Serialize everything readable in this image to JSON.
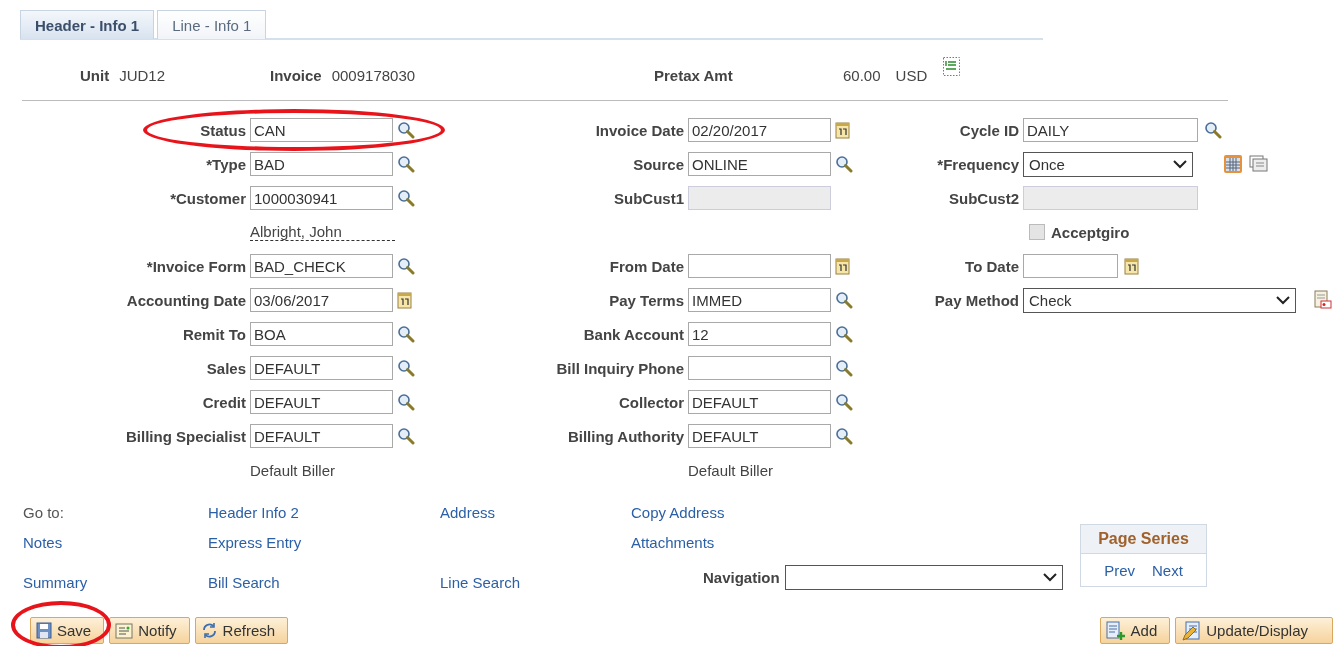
{
  "tabs": [
    {
      "label": "Header - Info 1",
      "selected": true
    },
    {
      "label": "Line - Info 1",
      "selected": false
    }
  ],
  "summary": [
    {
      "label": "Unit",
      "value": "JUD12"
    },
    {
      "label": "Invoice",
      "value": "0009178030"
    },
    {
      "label": "Pretax Amt",
      "value": "60.00",
      "currency": "USD"
    }
  ],
  "rows": [
    {
      "left": {
        "kind": "lookup",
        "label": "Status",
        "value": "CAN",
        "disabled": false,
        "circled": true
      },
      "middle": {
        "kind": "date",
        "label": "Invoice Date",
        "value": "02/20/2017",
        "disabled": false
      },
      "right": {
        "kind": "lookup",
        "label": "Cycle ID",
        "value": "DAILY",
        "disabled": false
      }
    },
    {
      "left": {
        "kind": "lookup",
        "label": "*Type",
        "value": "BAD",
        "disabled": false
      },
      "middle": {
        "kind": "lookup",
        "label": "Source",
        "value": "ONLINE",
        "disabled": false
      },
      "right": {
        "kind": "select",
        "label": "*Frequency",
        "value": "Once",
        "disabled": false
      }
    },
    {
      "left": {
        "kind": "lookup",
        "label": "*Customer",
        "value": "1000030941",
        "disabled": false
      },
      "middle": {
        "kind": "plain",
        "label": "SubCust1",
        "disabled": true
      },
      "right": {
        "kind": "plain",
        "label": "SubCust2",
        "disabled": true
      }
    },
    {
      "left": {
        "kind": "link",
        "value": "Albright, John"
      },
      "right": {
        "kind": "checkbox",
        "label": "Acceptgiro",
        "checked": false,
        "disabled": true
      }
    },
    {
      "left": {
        "kind": "lookup",
        "label": "*Invoice Form",
        "value": "BAD_CHECK",
        "disabled": false
      },
      "middle": {
        "kind": "date",
        "label": "From Date",
        "disabled": false
      },
      "right": {
        "kind": "date",
        "label": "To Date",
        "disabled": false
      }
    },
    {
      "left": {
        "kind": "date",
        "label": "Accounting Date",
        "value": "03/06/2017",
        "disabled": false
      },
      "middle": {
        "kind": "lookup",
        "label": "Pay Terms",
        "value": "IMMED",
        "disabled": false
      },
      "right": {
        "kind": "select",
        "label": "Pay Method",
        "value": "Check",
        "disabled": false
      }
    },
    {
      "left": {
        "kind": "lookup",
        "label": "Remit To",
        "value": "BOA",
        "disabled": false
      },
      "middle": {
        "kind": "lookup",
        "label": "Bank Account",
        "value": "12",
        "disabled": false
      }
    },
    {
      "left": {
        "kind": "lookup",
        "label": "Sales",
        "value": "DEFAULT",
        "disabled": false
      },
      "middle": {
        "kind": "lookup",
        "label": "Bill Inquiry Phone",
        "disabled": false
      }
    },
    {
      "left": {
        "kind": "lookup",
        "label": "Credit",
        "value": "DEFAULT",
        "disabled": false
      },
      "middle": {
        "kind": "lookup",
        "label": "Collector",
        "value": "DEFAULT",
        "disabled": false
      }
    },
    {
      "left": {
        "kind": "lookup",
        "label": "Billing Specialist",
        "value": "DEFAULT",
        "disabled": false
      },
      "middle": {
        "kind": "lookup",
        "label": "Billing Authority",
        "value": "DEFAULT",
        "disabled": false
      }
    },
    {
      "left": {
        "kind": "note",
        "value": "Default Biller"
      },
      "middle": {
        "kind": "note",
        "value": "Default Biller"
      }
    }
  ],
  "goto": {
    "label": "Go to:",
    "rows": [
      [
        null,
        "Header Info 2",
        "Address",
        "Copy Address"
      ],
      [
        "Notes",
        "Express Entry",
        null,
        "Attachments"
      ],
      [
        "Summary",
        "Bill Search",
        "Line Search"
      ]
    ]
  },
  "navigation": {
    "label": "Navigation"
  },
  "page_series": {
    "title": "Page Series",
    "prev": "Prev",
    "next": "Next"
  },
  "buttons_left": [
    {
      "kind": "save",
      "label": "Save",
      "circled": true
    },
    {
      "kind": "notify",
      "label": "Notify",
      "circled": false
    },
    {
      "kind": "refresh",
      "label": "Refresh",
      "circled": false
    }
  ],
  "buttons_right": [
    {
      "kind": "add",
      "label": "Add"
    },
    {
      "kind": "update",
      "label": "Update/Display"
    }
  ]
}
